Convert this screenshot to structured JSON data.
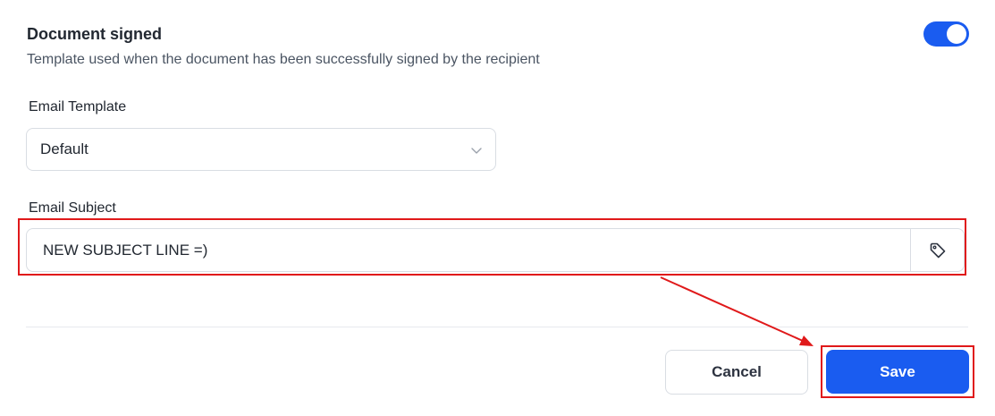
{
  "section": {
    "title": "Document signed",
    "description": "Template used when the document has been successfully signed by the recipient",
    "toggle_on": true
  },
  "email_template": {
    "label": "Email Template",
    "selected": "Default"
  },
  "email_subject": {
    "label": "Email Subject",
    "value": "NEW SUBJECT LINE =)"
  },
  "actions": {
    "cancel_label": "Cancel",
    "save_label": "Save"
  },
  "colors": {
    "accent": "#1a5cf0",
    "annotation": "#e0191a"
  },
  "icons": {
    "dropdown": "chevron-down-icon",
    "tag": "tag-icon"
  }
}
